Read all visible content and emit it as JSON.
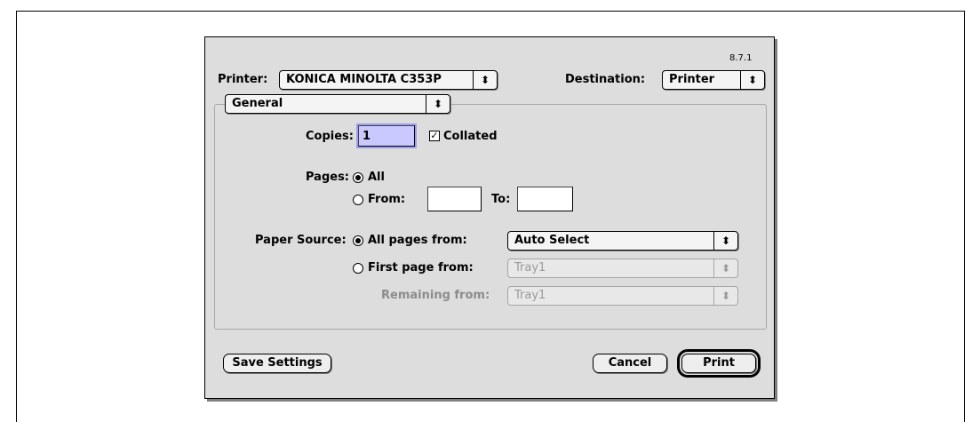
{
  "dialog": {
    "version": "8.7.1",
    "printer_label": "Printer:",
    "printer_value": "KONICA MINOLTA C353P",
    "destination_label": "Destination:",
    "destination_value": "Printer",
    "panel_value": "General",
    "copies_label": "Copies:",
    "copies_value": "1",
    "collated_label": "Collated",
    "collated_checked": true,
    "pages_label": "Pages:",
    "pages_all_label": "All",
    "pages_from_label": "From:",
    "pages_to_label": "To:",
    "pages_from_value": "",
    "pages_to_value": "",
    "paper_source_label": "Paper Source:",
    "all_pages_from_label": "All pages from:",
    "all_pages_from_value": "Auto Select",
    "first_page_from_label": "First page from:",
    "first_page_from_value": "Tray1",
    "remaining_from_label": "Remaining from:",
    "remaining_from_value": "Tray1",
    "save_settings_label": "Save Settings",
    "cancel_label": "Cancel",
    "print_label": "Print",
    "popup_arrow_glyph": "⬍",
    "check_glyph": "✓"
  }
}
